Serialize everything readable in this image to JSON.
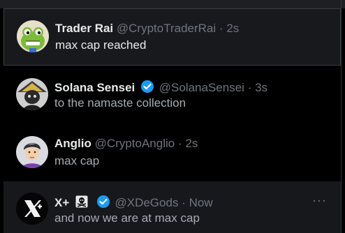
{
  "tweets": [
    {
      "name": "Trader Rai",
      "handle": "@CryptoTraderRai",
      "time": "2s",
      "text": "max cap reached",
      "avatar": "frog-avatar-icon",
      "verified": false
    },
    {
      "name": "Solana Sensei",
      "handle": "@SolanaSensei",
      "time": "3s",
      "text": "to the namaste collection",
      "avatar": "samurai-avatar-icon",
      "verified": true
    },
    {
      "name": "Anglio",
      "handle": "@CryptoAnglio",
      "time": "2s",
      "text": "max cap",
      "avatar": "person-avatar-icon",
      "verified": false
    },
    {
      "name": "X+",
      "handle": "@XDeGods",
      "time": "Now",
      "text": "and now we are at max cap",
      "avatar": "x-logo-avatar-icon",
      "verified": true,
      "name_emoji": "skull-crossbones-icon"
    }
  ],
  "separator": "·",
  "more_label": "···",
  "colors": {
    "verified": "#1d9bf0",
    "muted": "#71767b",
    "text": "#e7e9ea"
  }
}
